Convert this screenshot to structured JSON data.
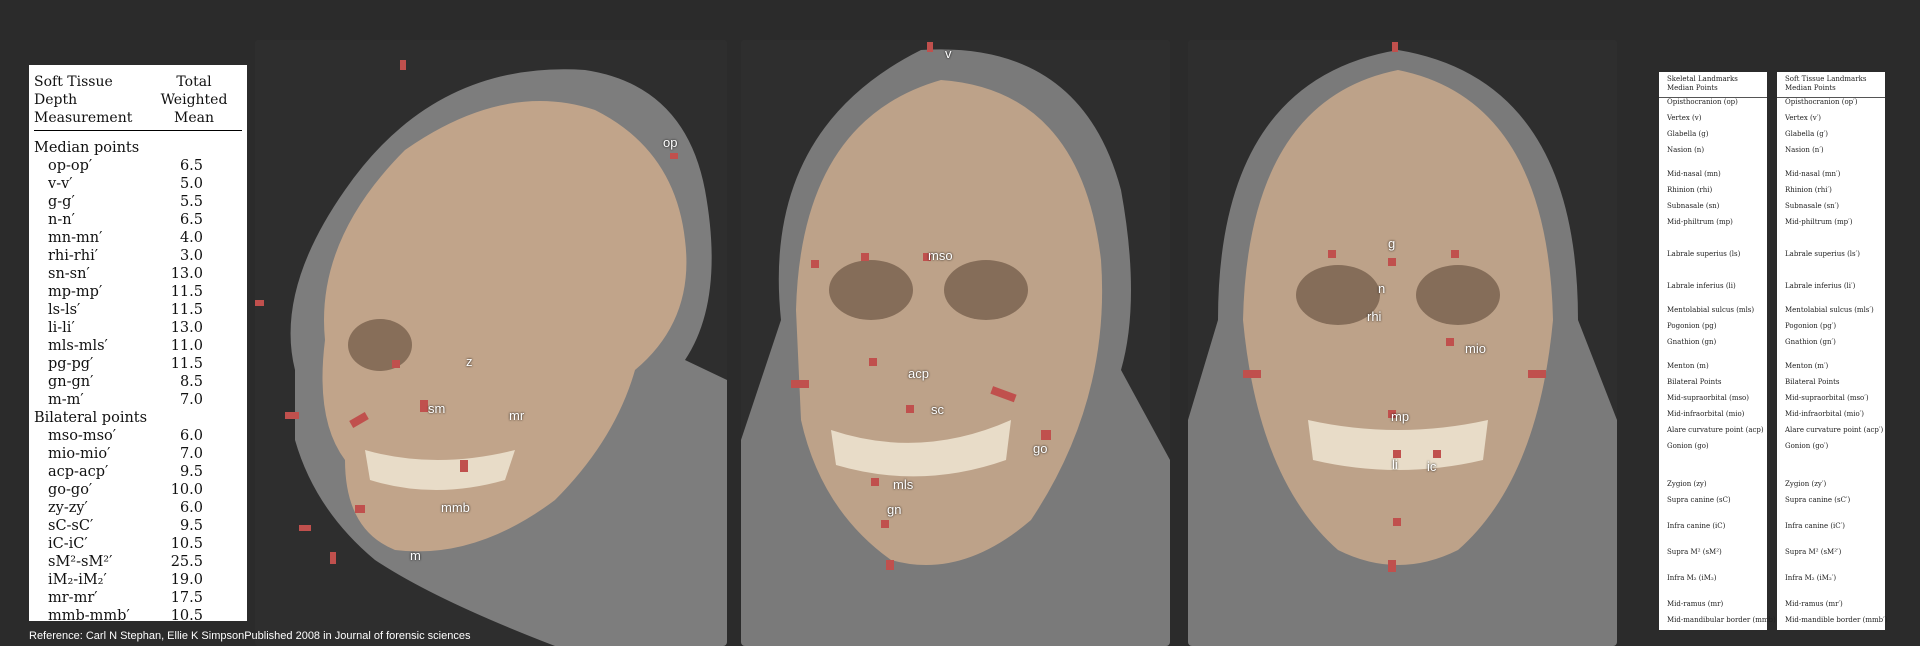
{
  "table": {
    "header_col1": [
      "Soft Tissue",
      "Depth",
      "Measurement"
    ],
    "header_col2": [
      "Total",
      "Weighted",
      "Mean"
    ],
    "rows": [
      {
        "label": "Median points",
        "value": "",
        "section": true
      },
      {
        "label": "op-op′",
        "value": "6.5"
      },
      {
        "label": "v-v′",
        "value": "5.0"
      },
      {
        "label": "g-g′",
        "value": "5.5"
      },
      {
        "label": "n-n′",
        "value": "6.5"
      },
      {
        "label": "mn-mn′",
        "value": "4.0"
      },
      {
        "label": "rhi-rhi′",
        "value": "3.0"
      },
      {
        "label": "sn-sn′",
        "value": "13.0"
      },
      {
        "label": "mp-mp′",
        "value": "11.5"
      },
      {
        "label": "ls-ls′",
        "value": "11.5"
      },
      {
        "label": "li-li′",
        "value": "13.0"
      },
      {
        "label": "mls-mls′",
        "value": "11.0"
      },
      {
        "label": "pg-pg′",
        "value": "11.5"
      },
      {
        "label": "gn-gn′",
        "value": "8.5"
      },
      {
        "label": "m-m′",
        "value": "7.0"
      },
      {
        "label": "Bilateral points",
        "value": "",
        "section": true
      },
      {
        "label": "mso-mso′",
        "value": "6.0"
      },
      {
        "label": "mio-mio′",
        "value": "7.0"
      },
      {
        "label": "acp-acp′",
        "value": "9.5"
      },
      {
        "label": "go-go′",
        "value": "10.0"
      },
      {
        "label": "zy-zy′",
        "value": "6.0"
      },
      {
        "label": "sC-sC′",
        "value": "9.5"
      },
      {
        "label": "iC-iC′",
        "value": "10.5"
      },
      {
        "label": "sM²-sM²′",
        "value": "25.5"
      },
      {
        "label": "iM₂-iM₂′",
        "value": "19.0"
      },
      {
        "label": "mr-mr′",
        "value": "17.5"
      },
      {
        "label": "mmb-mmb′",
        "value": "10.5"
      }
    ]
  },
  "photo_labels": {
    "side": [
      "op",
      "z",
      "sm",
      "mr",
      "mmb",
      "m"
    ],
    "front": [
      "v",
      "mso",
      "acp",
      "sc",
      "go",
      "mls",
      "gn"
    ],
    "front2": [
      "g",
      "n",
      "rhi",
      "mio",
      "mp",
      "li",
      "ic"
    ]
  },
  "skeletal": {
    "title": [
      "Skeletal Landmarks",
      "Median Points"
    ],
    "items": [
      "Opisthocranion (op)",
      "Vertex (v)",
      "Glabella (g)",
      "Nasion (n)",
      "Mid-nasal (mn)",
      "Rhinion (rhi)",
      "Subnasale (sn)",
      "Mid-philtrum (mp)",
      "Labrale superius (ls)",
      "Labrale inferius (li)",
      "Mentolabial sulcus (mls)",
      "Pogonion (pg)",
      "Gnathion (gn)",
      "Menton (m)",
      "Bilateral Points",
      "Mid-supraorbital (mso)",
      "Mid-infraorbital (mio)",
      "Alare curvature point (acp)",
      "Gonion (go)",
      "Zygion (zy)",
      "Supra canine (sC)",
      "Infra canine (iC)",
      "Supra M² (sM²)",
      "Infra M₂ (iM₂)",
      "Mid-ramus (mr)",
      "Mid-mandibular border (mmb)"
    ]
  },
  "soft": {
    "title": [
      "Soft Tissue Landmarks",
      "Median Points"
    ],
    "items": [
      "Opisthocranion (op′)",
      "Vertex (v′)",
      "Glabella (g′)",
      "Nasion (n′)",
      "Mid-nasal (mn′)",
      "Rhinion (rhi′)",
      "Subnasale (sn′)",
      "Mid-philtrum (mp′)",
      "Labrale superius (ls′)",
      "Labrale inferius (li′)",
      "Mentolabial sulcus (mls′)",
      "Pogonion (pg′)",
      "Gnathion (gn′)",
      "Menton (m′)",
      "Bilateral Points",
      "Mid-supraorbital (mso′)",
      "Mid-infraorbital (mio′)",
      "Alare curvature point (acp′)",
      "Gonion (go′)",
      "Zygion (zy′)",
      "Supra canine (sC′)",
      "Infra canine (iC′)",
      "Supra M² (sM²′)",
      "Infra M₂ (iM₂′)",
      "Mid-ramus (mr′)",
      "Mid-mandible border (mmb′)"
    ]
  },
  "caption": "Reference: Carl N Stephan, Ellie K SimpsonPublished 2008 in Journal of forensic sciences",
  "colors": {
    "background": "#2b2b2b",
    "marker": "#c0504d",
    "skull": "#c9a98c"
  }
}
